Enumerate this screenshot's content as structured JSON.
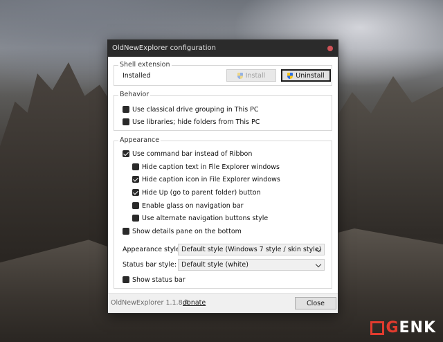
{
  "window": {
    "title": "OldNewExplorer configuration"
  },
  "shell_extension": {
    "title": "Shell extension",
    "status": "Installed",
    "install_label": "Install",
    "uninstall_label": "Uninstall"
  },
  "behavior": {
    "title": "Behavior",
    "options": [
      {
        "label": "Use classical drive grouping in This PC",
        "checked": false
      },
      {
        "label": "Use libraries; hide folders from This PC",
        "checked": false
      }
    ]
  },
  "appearance": {
    "title": "Appearance",
    "command_bar": {
      "label": "Use command bar instead of Ribbon",
      "checked": true
    },
    "sub_options": [
      {
        "label": "Hide caption text in File Explorer windows",
        "checked": false
      },
      {
        "label": "Hide caption icon in File Explorer windows",
        "checked": true
      },
      {
        "label": "Hide Up (go to parent folder) button",
        "checked": true
      },
      {
        "label": "Enable glass on navigation bar",
        "checked": false
      },
      {
        "label": "Use alternate navigation buttons style",
        "checked": false
      }
    ],
    "details_pane": {
      "label": "Show details pane on the bottom",
      "checked": false
    },
    "appearance_style": {
      "label": "Appearance style:",
      "value": "Default style (Windows 7 style / skin style)"
    },
    "status_bar_style": {
      "label": "Status bar style:",
      "value": "Default style (white)"
    },
    "show_status_bar": {
      "label": "Show status bar",
      "checked": false
    }
  },
  "footer": {
    "version": "OldNewExplorer 1.1.8.4",
    "donate_label": "donate",
    "close_label": "Close"
  },
  "watermark": {
    "text_g": "G",
    "text_rest": "ENK"
  },
  "colors": {
    "accent_red": "#d05257",
    "watermark_red": "#e23b2e",
    "titlebar": "#2b2b2b"
  }
}
